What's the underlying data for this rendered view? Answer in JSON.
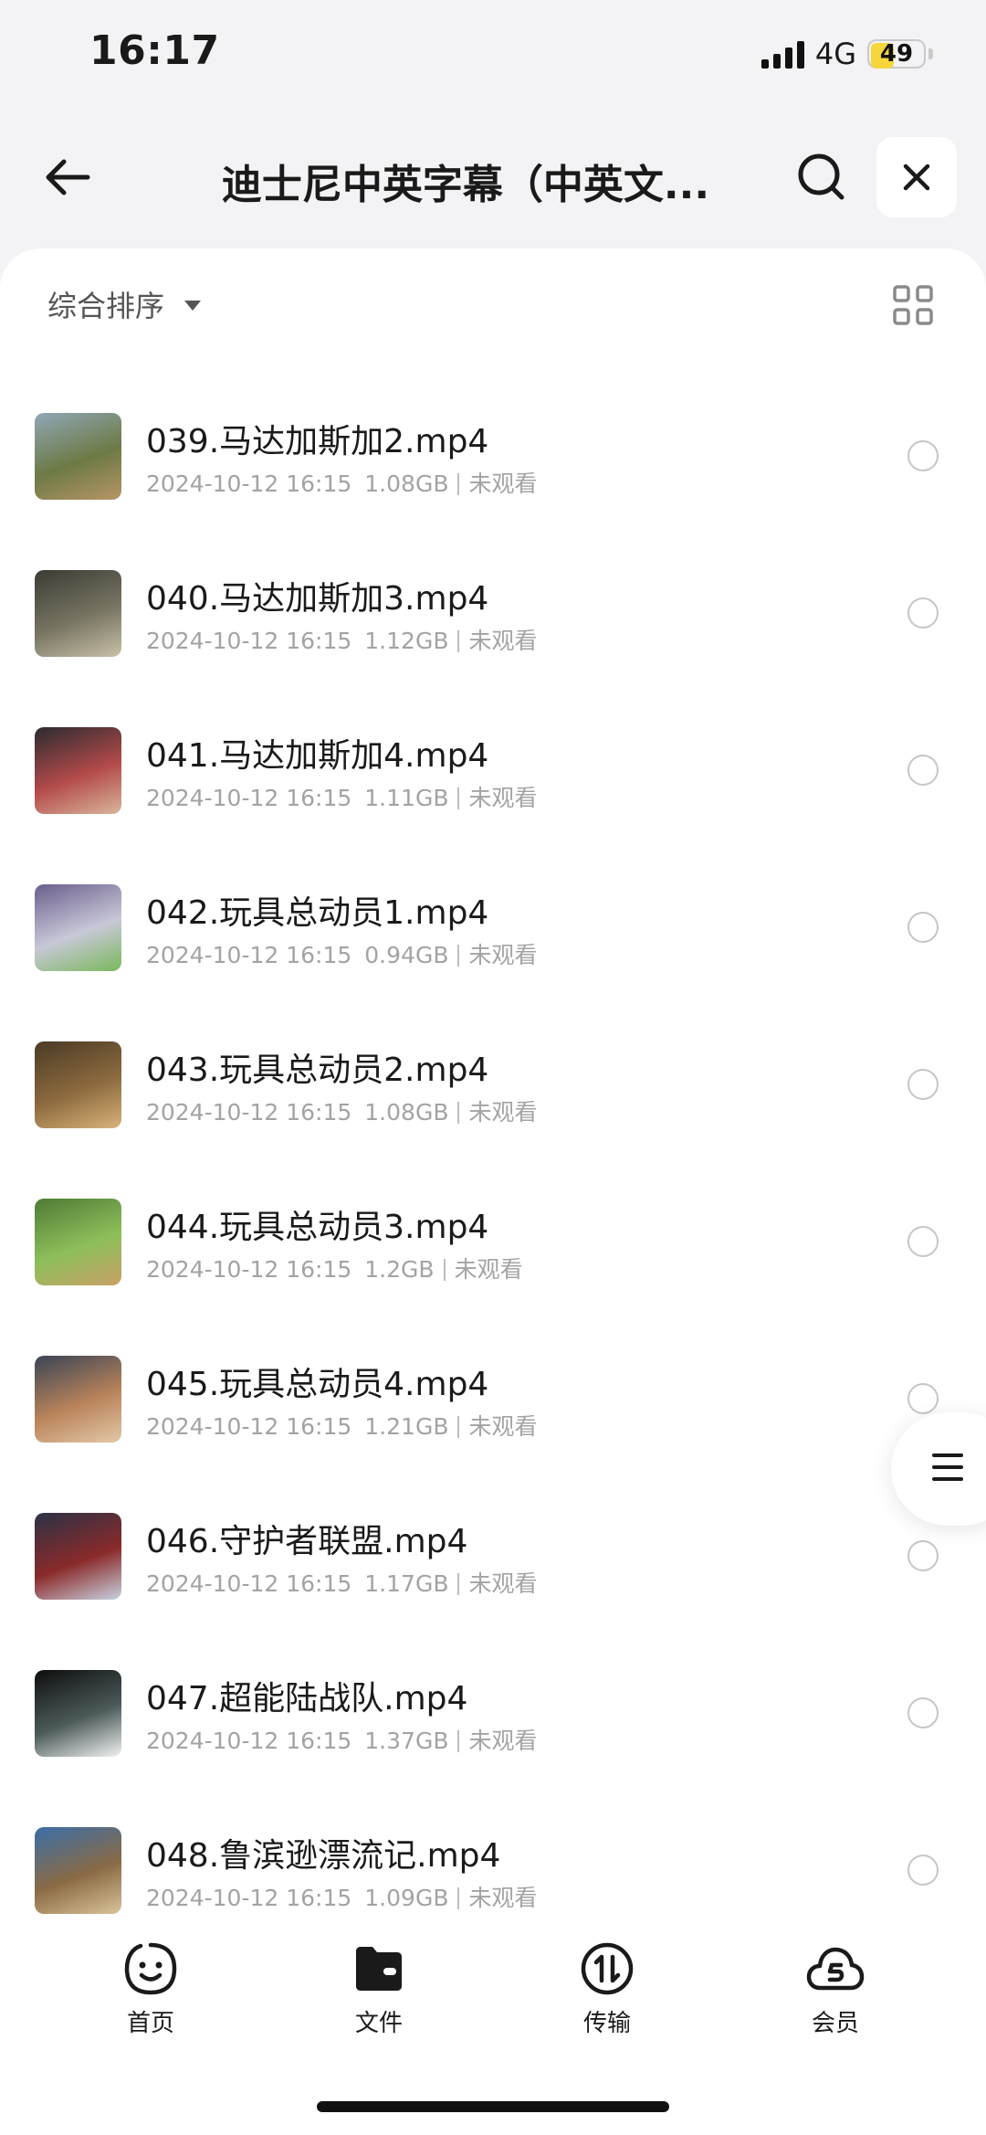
{
  "status_bar": {
    "time": "16:17",
    "network": "4G",
    "battery": "49",
    "battery_level": 0.49
  },
  "header": {
    "title": "迪士尼中英字幕（中英文...",
    "back_icon": "arrow-left-icon",
    "search_icon": "search-icon",
    "close_icon": "close-icon"
  },
  "toolbar": {
    "sort_label": "综合排序",
    "grid_icon": "grid-view-icon"
  },
  "files": [
    {
      "name": "039.马达加斯加2.mp4",
      "date": "2024-10-12 16:15",
      "size": "1.08GB",
      "status": "未观看",
      "thumb_colors": [
        "#8fa7b6",
        "#6d7a45",
        "#b79566"
      ]
    },
    {
      "name": "040.马达加斯加3.mp4",
      "date": "2024-10-12 16:15",
      "size": "1.12GB",
      "status": "未观看",
      "thumb_colors": [
        "#3b3b34",
        "#777462",
        "#c9c1a8"
      ]
    },
    {
      "name": "041.马达加斯加4.mp4",
      "date": "2024-10-12 16:15",
      "size": "1.11GB",
      "status": "未观看",
      "thumb_colors": [
        "#2b2a2f",
        "#b34a4a",
        "#d9b59a"
      ]
    },
    {
      "name": "042.玩具总动员1.mp4",
      "date": "2024-10-12 16:15",
      "size": "0.94GB",
      "status": "未观看",
      "thumb_colors": [
        "#6b5e8c",
        "#c8c8d8",
        "#7ab85a"
      ]
    },
    {
      "name": "043.玩具总动员2.mp4",
      "date": "2024-10-12 16:15",
      "size": "1.08GB",
      "status": "未观看",
      "thumb_colors": [
        "#4a3a26",
        "#8c6a3e",
        "#d9b27a"
      ]
    },
    {
      "name": "044.玩具总动员3.mp4",
      "date": "2024-10-12 16:15",
      "size": "1.2GB",
      "status": "未观看",
      "thumb_colors": [
        "#4f7a36",
        "#8cbf5a",
        "#c9a066"
      ]
    },
    {
      "name": "045.玩具总动员4.mp4",
      "date": "2024-10-12 16:15",
      "size": "1.21GB",
      "status": "未观看",
      "thumb_colors": [
        "#3a4456",
        "#b9835a",
        "#e3c8a8"
      ]
    },
    {
      "name": "046.守护者联盟.mp4",
      "date": "2024-10-12 16:15",
      "size": "1.17GB",
      "status": "未观看",
      "thumb_colors": [
        "#2b3246",
        "#8a2a2a",
        "#c9d2e0"
      ]
    },
    {
      "name": "047.超能陆战队.mp4",
      "date": "2024-10-12 16:15",
      "size": "1.37GB",
      "status": "未观看",
      "thumb_colors": [
        "#0d0d0d",
        "#4c5a5a",
        "#f2f2f2"
      ]
    },
    {
      "name": "048.鲁滨逊漂流记.mp4",
      "date": "2024-10-12 16:15",
      "size": "1.09GB",
      "status": "未观看",
      "thumb_colors": [
        "#3a6fa8",
        "#8a6a44",
        "#d9c39a"
      ]
    }
  ],
  "float_button": {
    "icon": "list-menu-icon"
  },
  "tabs": [
    {
      "label": "首页",
      "icon": "smile-face-icon"
    },
    {
      "label": "文件",
      "icon": "folder-icon"
    },
    {
      "label": "传输",
      "icon": "transfer-icon"
    },
    {
      "label": "会员",
      "icon": "cloud-vip-icon"
    }
  ]
}
